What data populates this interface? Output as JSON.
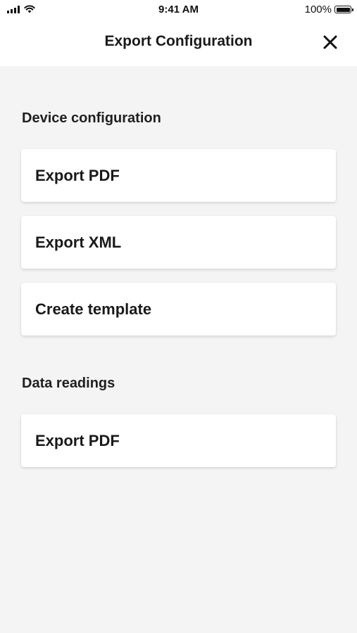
{
  "status_bar": {
    "time": "9:41 AM",
    "battery_percent": "100%",
    "icons": [
      "signal-icon",
      "wifi-icon",
      "battery-icon"
    ]
  },
  "header": {
    "title": "Export Configuration",
    "close_icon": "close-icon"
  },
  "sections": [
    {
      "title": "Device configuration",
      "items": [
        {
          "label": "Export PDF"
        },
        {
          "label": "Export XML"
        },
        {
          "label": "Create template"
        }
      ]
    },
    {
      "title": "Data readings",
      "items": [
        {
          "label": "Export PDF"
        }
      ]
    }
  ],
  "colors": {
    "background": "#f4f4f4",
    "surface": "#ffffff",
    "text": "#1a1a1a"
  }
}
